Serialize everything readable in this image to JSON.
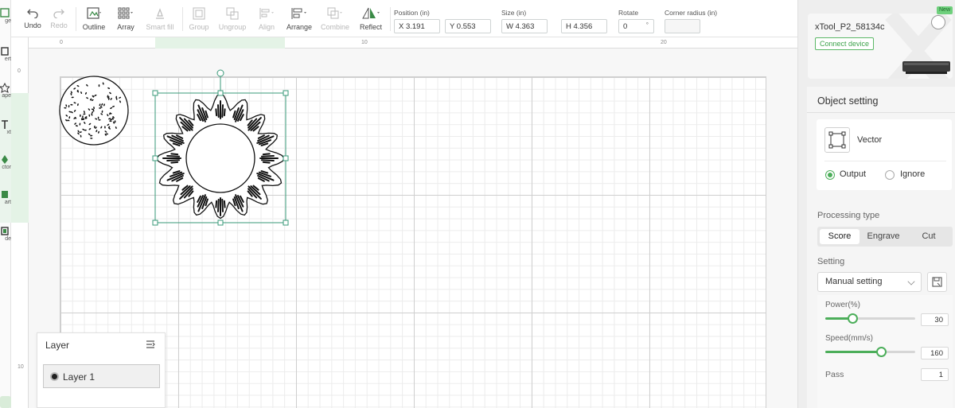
{
  "left_tools": [
    {
      "label": "ge",
      "icon": "image-icon"
    },
    {
      "label": "ert",
      "icon": "insert-icon"
    },
    {
      "label": "ape",
      "icon": "shape-icon"
    },
    {
      "label": "xt",
      "icon": "text-icon"
    },
    {
      "label": "ctor",
      "icon": "vector-pen-icon"
    },
    {
      "label": "art",
      "icon": "art-icon"
    },
    {
      "label": "de",
      "icon": "code-icon"
    }
  ],
  "toolbar": {
    "undo": "Undo",
    "redo": "Redo",
    "outline": "Outline",
    "array": "Array",
    "smart_fill": "Smart fill",
    "group": "Group",
    "ungroup": "Ungroup",
    "align": "Align",
    "arrange": "Arrange",
    "combine": "Combine",
    "reflect": "Reflect",
    "position_label": "Position (in)",
    "x_value": "X  3.191",
    "y_value": "Y  0.553",
    "size_label": "Size (in)",
    "w_value": "W  4.363",
    "h_value": "H  4.356",
    "rotate_label": "Rotate",
    "rotate_value": "0",
    "rotate_unit": "°",
    "corner_label": "Corner radius (in)",
    "corner_value": ""
  },
  "ruler": {
    "top": [
      "0",
      "10",
      "20"
    ],
    "left": [
      "0",
      "10"
    ]
  },
  "layer_panel": {
    "title": "Layer",
    "layers": [
      {
        "name": "Layer 1"
      }
    ]
  },
  "device": {
    "name": "xTool_P2_58134c",
    "connect_label": "Connect device",
    "new_badge": "New"
  },
  "object_setting": {
    "title": "Object setting",
    "object_type": "Vector",
    "output_label": "Output",
    "ignore_label": "Ignore",
    "selected": "Output"
  },
  "processing": {
    "label": "Processing type",
    "options": [
      "Score",
      "Engrave",
      "Cut"
    ],
    "selected": "Score"
  },
  "setting": {
    "label": "Setting",
    "mode": "Manual setting",
    "power_label": "Power(%)",
    "power_value": "30",
    "power_fraction": 0.3,
    "speed_label": "Speed(mm/s)",
    "speed_value": "160",
    "speed_fraction": 0.62,
    "pass_label": "Pass",
    "pass_value": "1"
  },
  "colors": {
    "accent": "#4cae5a",
    "selection": "#3a9a7a"
  }
}
